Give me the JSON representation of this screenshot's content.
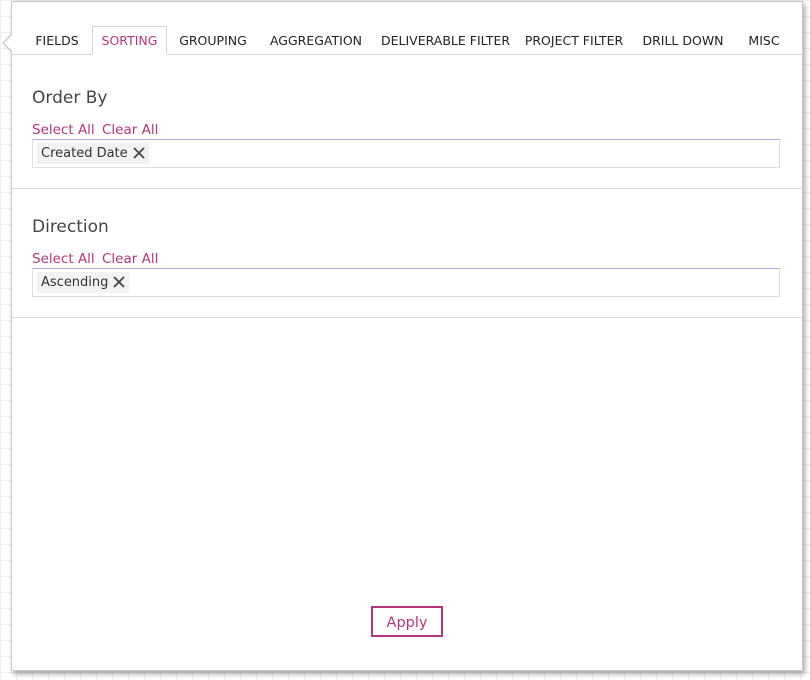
{
  "tabs": [
    {
      "label": "FIELDS"
    },
    {
      "label": "SORTING"
    },
    {
      "label": "GROUPING"
    },
    {
      "label": "AGGREGATION"
    },
    {
      "label": "DELIVERABLE FILTER"
    },
    {
      "label": "PROJECT FILTER"
    },
    {
      "label": "DRILL DOWN"
    },
    {
      "label": "MISC"
    }
  ],
  "active_tab": "SORTING",
  "order_by": {
    "title": "Order By",
    "select_all": "Select All",
    "clear_all": "Clear All",
    "chips": [
      {
        "label": "Created Date"
      }
    ]
  },
  "direction": {
    "title": "Direction",
    "select_all": "Select All",
    "clear_all": "Clear All",
    "chips": [
      {
        "label": "Ascending"
      }
    ]
  },
  "apply_label": "Apply",
  "colors": {
    "accent": "#b4357e",
    "text": "#222222",
    "border": "#d4d4d4",
    "chip_bg": "#f2f2f2"
  },
  "icons": {
    "chip_remove": "close-icon"
  }
}
